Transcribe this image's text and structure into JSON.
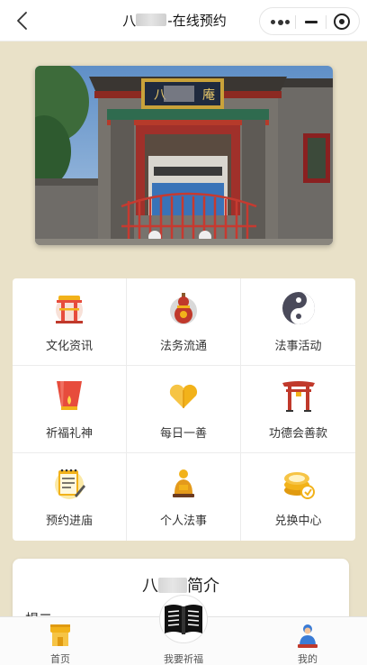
{
  "navbar": {
    "title_visible": "-在线预约",
    "title_prefix_visible": "八",
    "back_icon": "chevron-left-icon",
    "capsule": {
      "more_icon": "more-dots-icon",
      "minimize_icon": "minimize-icon",
      "close_icon": "target-close-icon"
    }
  },
  "banner": {
    "alt": "temple gate photo",
    "plaque_char_left": "八",
    "plaque_char_right": "庵"
  },
  "menu": {
    "items": [
      {
        "label": "文化资讯",
        "icon": "pavilion-icon"
      },
      {
        "label": "法务流通",
        "icon": "gourd-icon"
      },
      {
        "label": "法事活动",
        "icon": "yin-yang-icon"
      },
      {
        "label": "祈福礼神",
        "icon": "sky-lantern-icon"
      },
      {
        "label": "每日一善",
        "icon": "heart-icon"
      },
      {
        "label": "功德会善款",
        "icon": "gate-icon"
      },
      {
        "label": "预约进庙",
        "icon": "notepad-icon"
      },
      {
        "label": "个人法事",
        "icon": "person-icon"
      },
      {
        "label": "兑换中心",
        "icon": "coins-icon"
      }
    ]
  },
  "intro": {
    "title_prefix_visible": "八",
    "title_suffix_visible": "简介",
    "peek_text": "楊二"
  },
  "tabbar": {
    "home_label": "首页",
    "pray_label": "我要祈福",
    "mine_label": "我的"
  },
  "colors": {
    "background": "#e9e1c8",
    "card": "#ffffff",
    "accent_red": "#c0392b",
    "accent_gold": "#f2b21a"
  }
}
